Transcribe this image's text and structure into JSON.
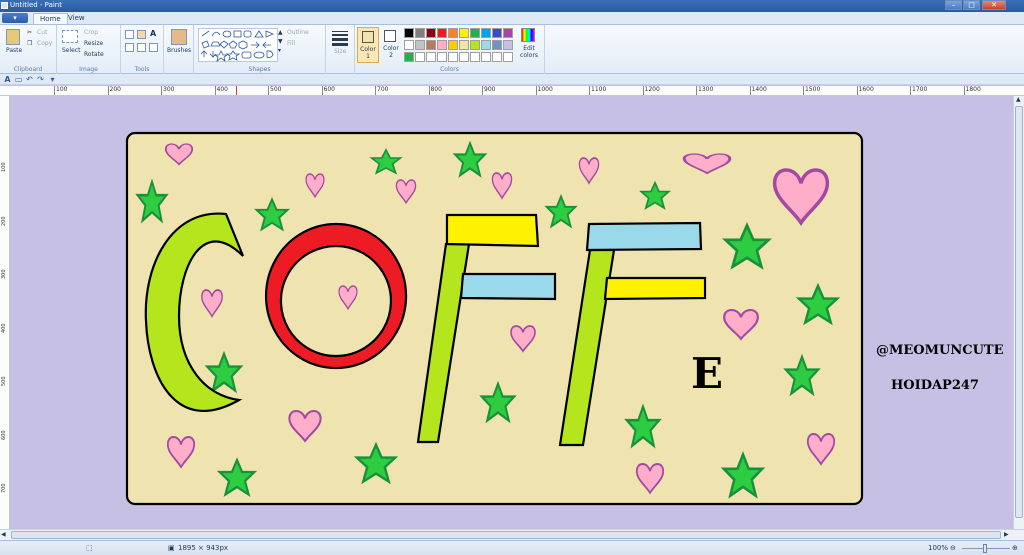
{
  "window": {
    "title": "Untitled - Paint",
    "minimize": "–",
    "maximize": "□",
    "close": "✕"
  },
  "tabs": {
    "file": "▾",
    "home": "Home",
    "view": "View"
  },
  "ribbon": {
    "clipboard": {
      "label": "Clipboard",
      "paste": "Paste",
      "cut": "Cut",
      "copy": "Copy"
    },
    "image": {
      "label": "Image",
      "select": "Select",
      "crop": "Crop",
      "resize": "Resize",
      "rotate": "Rotate"
    },
    "tools": {
      "label": "Tools"
    },
    "brushes": {
      "label": "Brushes"
    },
    "shapes": {
      "label": "Shapes",
      "outline": "Outline",
      "fill": "Fill"
    },
    "size": {
      "label": "Size"
    },
    "colors": {
      "label": "Colors",
      "color1": "Color 1",
      "color2": "Color 2",
      "edit": "Edit colors"
    }
  },
  "palette": [
    "#000000",
    "#7f7f7f",
    "#880015",
    "#ed1c24",
    "#ff7f27",
    "#fff200",
    "#22b14c",
    "#00a2e8",
    "#3f48cc",
    "#a349a4",
    "#ffffff",
    "#c3c3c3",
    "#b97a57",
    "#ffaec9",
    "#ffc90e",
    "#efe4b0",
    "#b5e61d",
    "#99d9ea",
    "#7092be",
    "#c8bfe7",
    "#22b14c",
    "#ffffff",
    "#ffffff",
    "#ffffff",
    "#ffffff",
    "#ffffff",
    "#ffffff",
    "#ffffff",
    "#ffffff",
    "#ffffff"
  ],
  "ruler": {
    "h": [
      "100",
      "200",
      "300",
      "400",
      "500",
      "600",
      "700",
      "800",
      "900",
      "1000",
      "1100",
      "1200",
      "1300",
      "1400",
      "1500",
      "1600",
      "1700",
      "1800"
    ],
    "v": [
      "100",
      "200",
      "300",
      "400",
      "500",
      "600",
      "700"
    ]
  },
  "drawing": {
    "letters": {
      "c": "C",
      "o": "O",
      "f1": "F",
      "f2": "F",
      "e": "E"
    },
    "tag1": "@MEOMUNCUTE",
    "tag2": "HOIDAP247",
    "colors": {
      "board": "#efe4b0",
      "green": "#b5e61d",
      "red": "#ed1c24",
      "yellow": "#fff200",
      "blue": "#99d9ea",
      "pink": "#ffaec9",
      "heart_stroke": "#a349a4",
      "star": "#2ecc40"
    }
  },
  "status": {
    "dimensions": "1895 × 943px",
    "zoom": "100%"
  }
}
